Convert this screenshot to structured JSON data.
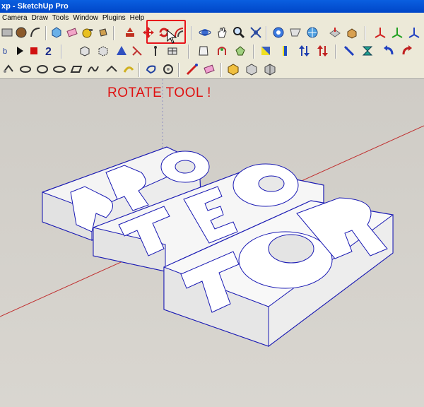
{
  "window": {
    "title": "xp - SketchUp Pro"
  },
  "menu": [
    "Camera",
    "Draw",
    "Tools",
    "Window",
    "Plugins",
    "Help"
  ],
  "annotation": "ROTATE TOOL !",
  "model_letters": [
    "P",
    "R",
    "O",
    "T",
    "E",
    "C",
    "T",
    "O",
    "R"
  ],
  "colors": {
    "highlight": "#e8141a",
    "edges": "#1a1ab4",
    "axis_red": "#c03030",
    "annotation": "#e01010"
  },
  "toolbar_row1": [
    "rectangle-icon",
    "circle-icon",
    "arc-icon",
    "make-component-icon",
    "eraser-icon",
    "paint-bucket-icon",
    "tape-measure-icon",
    "push-pull-icon",
    "move-icon",
    "rotate-icon",
    "offset-icon",
    "orbit-icon",
    "pan-icon",
    "zoom-icon",
    "zoom-extents-icon",
    "previous-view-icon",
    "next-view-icon",
    "add-location-icon",
    "terrain-icon",
    "sandbox-icon",
    "sandbox-drape-icon"
  ],
  "toolbar_row2": [
    "record-icon",
    "play-icon",
    "stop-icon",
    "help-icon",
    "iso-view-icon",
    "top-view-icon",
    "front-view-icon",
    "right-view-icon",
    "back-view-icon",
    "left-view-icon",
    "section-plane-icon",
    "xray-icon",
    "wireframe-icon",
    "shaded-icon",
    "intersect-icon",
    "flip-icon",
    "reverse-icon"
  ],
  "toolbar_row3": [
    "select-icon",
    "lasso-icon",
    "loop-icon",
    "ellipse-icon",
    "polygon-icon",
    "freehand-icon",
    "dimension-icon",
    "text-icon",
    "protractor-icon",
    "axes-icon",
    "3d-text-icon",
    "pencil-icon",
    "paint-icon",
    "component-a-icon",
    "component-b-icon",
    "component-c-icon"
  ]
}
